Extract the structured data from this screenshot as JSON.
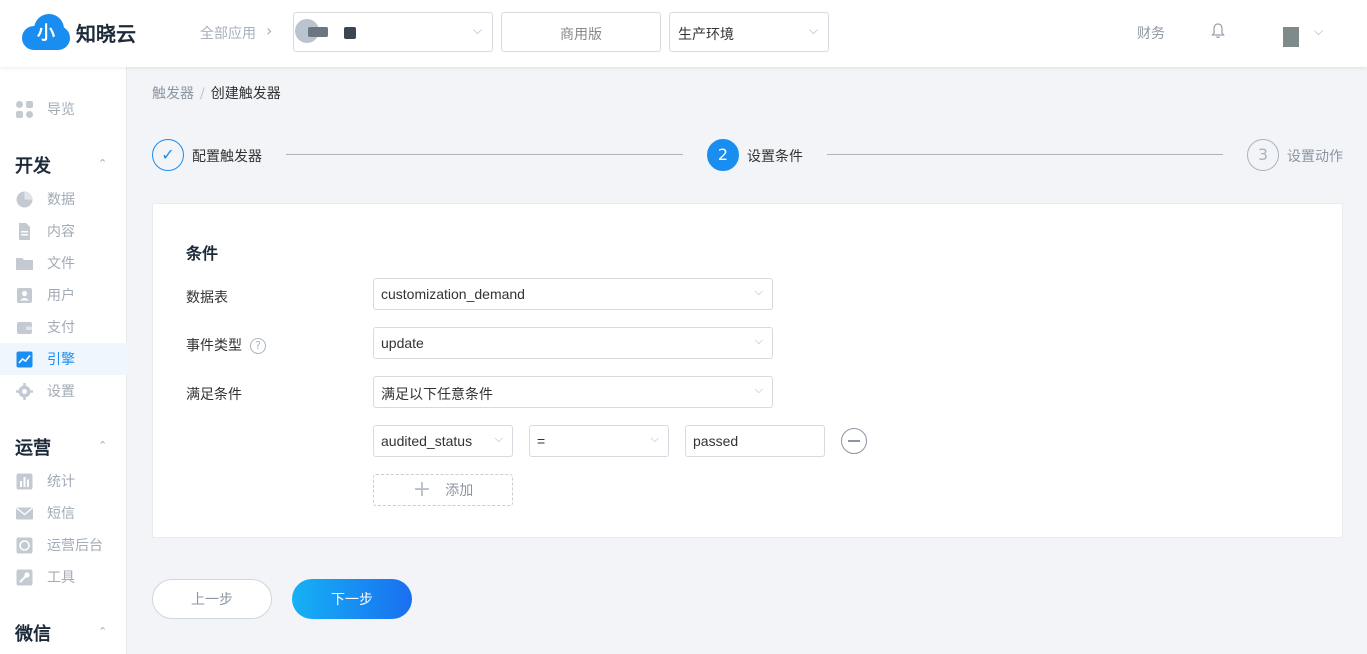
{
  "header": {
    "logo_text": "知晓云",
    "all_apps": "全部应用",
    "app_select_value": "",
    "version_label": "商用版",
    "env_select_value": "生产环境",
    "finance": "财务"
  },
  "sidebar": {
    "items_top": [
      {
        "label": "导览",
        "icon": "grid-icon"
      }
    ],
    "groups": [
      {
        "title": "开发",
        "items": [
          {
            "label": "数据",
            "icon": "pie-chart-icon"
          },
          {
            "label": "内容",
            "icon": "document-icon"
          },
          {
            "label": "文件",
            "icon": "folder-icon"
          },
          {
            "label": "用户",
            "icon": "user-icon"
          },
          {
            "label": "支付",
            "icon": "wallet-icon"
          },
          {
            "label": "引擎",
            "icon": "trend-chart-icon",
            "active": true
          },
          {
            "label": "设置",
            "icon": "gear-icon"
          }
        ]
      },
      {
        "title": "运营",
        "items": [
          {
            "label": "统计",
            "icon": "bar-chart-icon"
          },
          {
            "label": "短信",
            "icon": "envelope-icon"
          },
          {
            "label": "运营后台",
            "icon": "admin-icon"
          },
          {
            "label": "工具",
            "icon": "wrench-icon"
          }
        ]
      },
      {
        "title": "微信",
        "items": []
      }
    ]
  },
  "breadcrumb": {
    "parent": "触发器",
    "separator": "/",
    "current": "创建触发器"
  },
  "steps": [
    {
      "label": "配置触发器",
      "marker": "✓",
      "state": "done"
    },
    {
      "label": "设置条件",
      "marker": "2",
      "state": "active"
    },
    {
      "label": "设置动作",
      "marker": "3",
      "state": "pending"
    }
  ],
  "form": {
    "title": "条件",
    "table_label": "数据表",
    "table_value": "customization_demand",
    "event_label": "事件类型",
    "event_help": "?",
    "event_value": "update",
    "match_label": "满足条件",
    "match_value": "满足以下任意条件",
    "condition": {
      "field": "audited_status",
      "operator": "=",
      "value": "passed"
    },
    "add_label": "添加"
  },
  "buttons": {
    "prev": "上一步",
    "next": "下一步"
  },
  "colors": {
    "primary": "#1a8df0",
    "muted": "#a2abb6"
  }
}
